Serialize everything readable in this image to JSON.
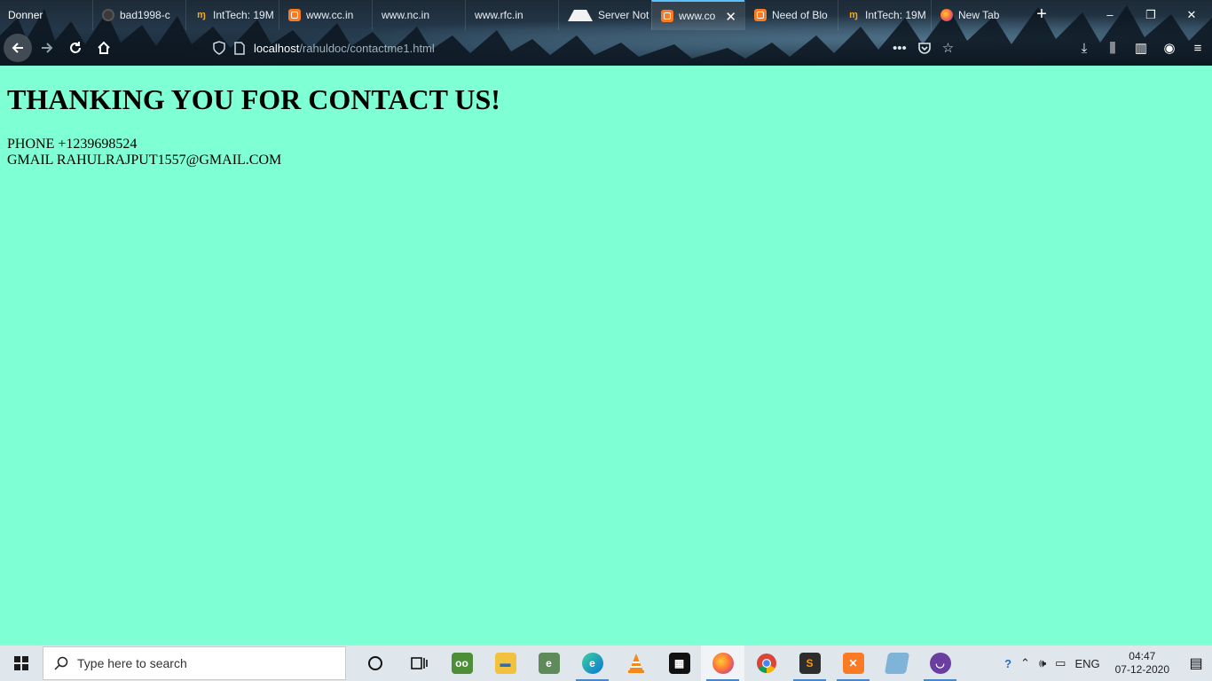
{
  "window": {
    "title": "Donner",
    "controls": [
      "–",
      "❐",
      "✕"
    ]
  },
  "tabs": [
    {
      "label": "bad1998-c",
      "icon": "github-icon"
    },
    {
      "label": "IntTech: 19M",
      "icon": "inttech-icon"
    },
    {
      "label": "www.cc.in",
      "icon": "xampp-icon"
    },
    {
      "label": "www.nc.in",
      "icon": ""
    },
    {
      "label": "www.rfc.in",
      "icon": ""
    },
    {
      "label": "Server Not F",
      "icon": "warning-icon"
    },
    {
      "label": "www.co",
      "icon": "xampp-icon",
      "active": true
    },
    {
      "label": "Need of Blo",
      "icon": "xampp-icon"
    },
    {
      "label": "IntTech: 19M",
      "icon": "inttech-icon"
    },
    {
      "label": "New Tab",
      "icon": "firefox-icon"
    }
  ],
  "nav": {
    "url_host": "localhost",
    "url_path": "/rahuldoc/contactme1.html"
  },
  "page": {
    "heading": "THANKING YOU FOR CONTACT US!",
    "phone_line": "PHONE +1239698524",
    "gmail_line": "GMAIL RAHULRAJPUT1557@GMAIL.COM",
    "background_color": "#7fffd4"
  },
  "taskbar": {
    "search_placeholder": "Type here to search",
    "lang": "ENG",
    "time": "04:47",
    "date": "07-12-2020",
    "apps": [
      "cortana",
      "task-view",
      "tripadvisor",
      "file-explorer",
      "evernote",
      "edge",
      "vlc",
      "store",
      "firefox",
      "chrome",
      "sublime",
      "xampp",
      "notepad",
      "vpn"
    ]
  }
}
